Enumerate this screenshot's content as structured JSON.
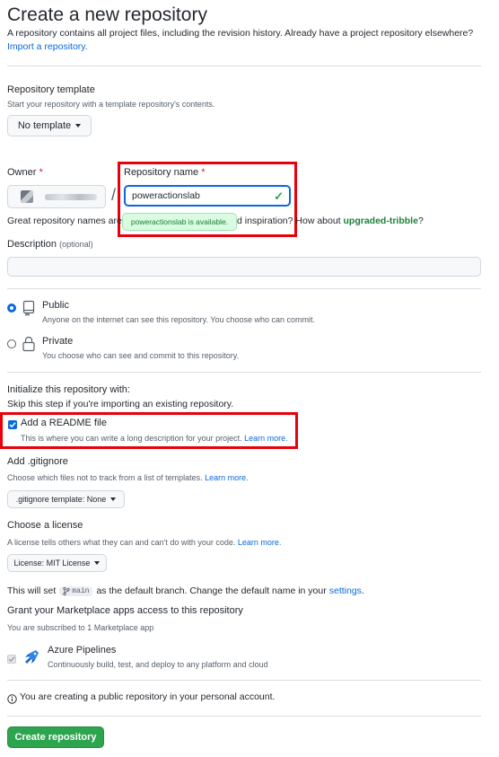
{
  "header": {
    "title": "Create a new repository",
    "subtitle": "A repository contains all project files, including the revision history. Already have a project repository elsewhere?",
    "import_link": "Import a repository."
  },
  "template": {
    "label": "Repository template",
    "hint": "Start your repository with a template repository's contents.",
    "button": "No template"
  },
  "owner": {
    "label": "Owner",
    "required_mark": "*",
    "separator": "/"
  },
  "repo_name": {
    "label": "Repository name",
    "required_mark": "*",
    "value": "poweractionslab",
    "availability": "poweractionslab is available."
  },
  "suggestion": {
    "prefix": "Great repository names are",
    "middle": "d inspiration?",
    "how_about": "How about",
    "name": "upgraded-tribble",
    "suffix": "?"
  },
  "description": {
    "label": "Description",
    "optional": "(optional)",
    "value": ""
  },
  "visibility": {
    "public": {
      "label": "Public",
      "hint": "Anyone on the internet can see this repository. You choose who can commit.",
      "selected": true
    },
    "private": {
      "label": "Private",
      "hint": "You choose who can see and commit to this repository.",
      "selected": false
    }
  },
  "initialize": {
    "heading": "Initialize this repository with:",
    "hint": "Skip this step if you're importing an existing repository.",
    "readme": {
      "label": "Add a README file",
      "hint": "This is where you can write a long description for your project.",
      "link": "Learn more.",
      "checked": true
    }
  },
  "gitignore": {
    "heading": "Add .gitignore",
    "hint": "Choose which files not to track from a list of templates.",
    "link": "Learn more.",
    "button": ".gitignore template: None"
  },
  "license": {
    "heading": "Choose a license",
    "hint": "A license tells others what they can and can't do with your code.",
    "link": "Learn more.",
    "button": "License: MIT License"
  },
  "branch": {
    "prefix": "This will set",
    "name": "main",
    "middle": "as the default branch. Change the default name in your",
    "link": "settings",
    "suffix": "."
  },
  "marketplace": {
    "heading": "Grant your Marketplace apps access to this repository",
    "hint": "You are subscribed to 1 Marketplace app",
    "app_name": "Azure Pipelines",
    "app_desc": "Continuously build, test, and deploy to any platform and cloud"
  },
  "notice": {
    "text": "You are creating a public repository in your personal account."
  },
  "submit": {
    "label": "Create repository"
  },
  "colors": {
    "accent": "#0969da",
    "create_button": "#2da44e",
    "highlight_box": "#e8000b",
    "available": "#1a7f37"
  },
  "icons": [
    "repo-icon",
    "lock-icon",
    "info-icon",
    "branch-icon",
    "check-icon",
    "azure-pipelines-icon"
  ]
}
